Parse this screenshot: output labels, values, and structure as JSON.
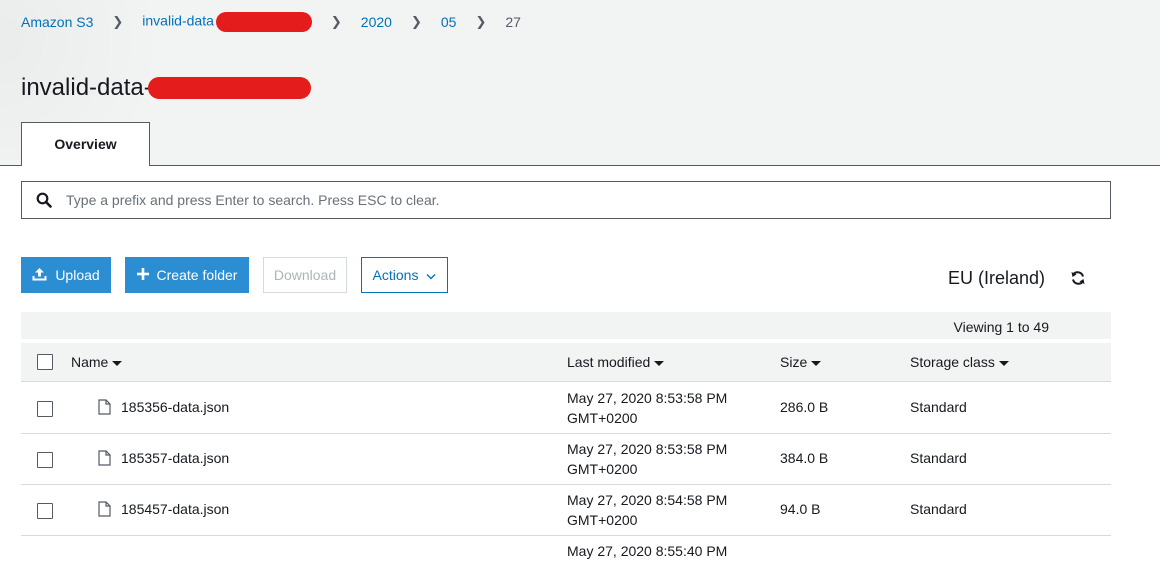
{
  "breadcrumb": {
    "root": "Amazon S3",
    "bucket": "invalid-data",
    "year": "2020",
    "month": "05",
    "day": "27"
  },
  "title": "invalid-data-",
  "tabs": [
    {
      "label": "Overview",
      "active": true
    }
  ],
  "search": {
    "placeholder": "Type a prefix and press Enter to search. Press ESC to clear."
  },
  "toolbar": {
    "upload": "Upload",
    "create_folder": "Create folder",
    "download": "Download",
    "actions": "Actions"
  },
  "region": "EU (Ireland)",
  "viewing": "Viewing 1 to 49",
  "table": {
    "columns": [
      "Name",
      "Last modified",
      "Size",
      "Storage class"
    ],
    "rows": [
      {
        "name": "185356-data.json",
        "modified_line1": "May 27, 2020 8:53:58 PM",
        "modified_line2": "GMT+0200",
        "size": "286.0 B",
        "class": "Standard"
      },
      {
        "name": "185357-data.json",
        "modified_line1": "May 27, 2020 8:53:58 PM",
        "modified_line2": "GMT+0200",
        "size": "384.0 B",
        "class": "Standard"
      },
      {
        "name": "185457-data.json",
        "modified_line1": "May 27, 2020 8:54:58 PM",
        "modified_line2": "GMT+0200",
        "size": "94.0 B",
        "class": "Standard"
      }
    ],
    "partial_row_modified": "May 27, 2020 8:55:40 PM"
  },
  "colors": {
    "link": "#0073bb",
    "primary": "#2b8ed3",
    "redaction": "#e51c1c",
    "header_bg": "#f2f3f3"
  },
  "icons": [
    "chevron-right-icon",
    "search-icon",
    "upload-icon",
    "plus-icon",
    "chevron-down-icon",
    "refresh-icon",
    "file-icon",
    "sort-caret-icon"
  ]
}
